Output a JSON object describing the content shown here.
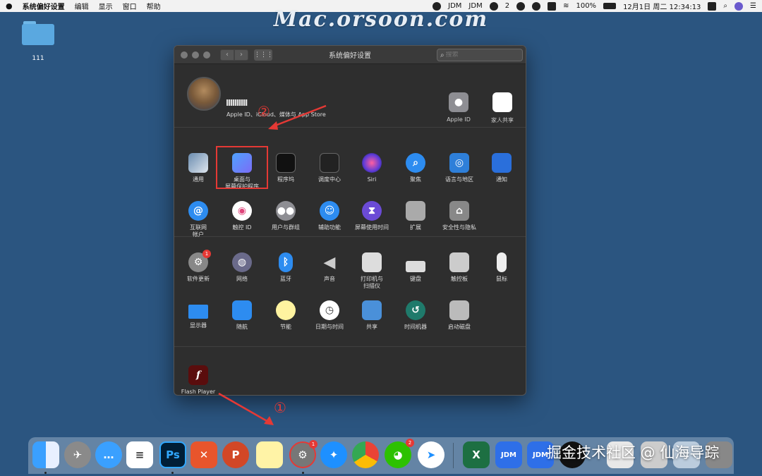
{
  "menubar": {
    "apple": "",
    "app_name": "系统偏好设置",
    "menus": [
      "编辑",
      "显示",
      "窗口",
      "帮助"
    ],
    "jdm1": "JDM",
    "jdm2": "JDM",
    "wechat_count": "2",
    "battery": "100%",
    "datetime": "12月1日 周二  12:34:13"
  },
  "watermark": "Mac.orsoon.com",
  "bottom_watermark": "掘金技术社区 @ 仙海导踪",
  "desktop": {
    "folder_label": "111"
  },
  "window": {
    "title": "系统偏好设置",
    "search_placeholder": "搜索",
    "grid_button": "⋮⋮⋮"
  },
  "account": {
    "description": "Apple ID、iCloud、媒体与 App Store",
    "apple_id": "Apple ID",
    "family": "家人共享"
  },
  "row1": [
    {
      "label": "通用",
      "name": "general"
    },
    {
      "label": "桌面与\n屏幕保护程序",
      "name": "desktop-screensaver"
    },
    {
      "label": "程序坞",
      "name": "dock"
    },
    {
      "label": "调度中心",
      "name": "mission-control"
    },
    {
      "label": "Siri",
      "name": "siri"
    },
    {
      "label": "聚焦",
      "name": "spotlight"
    },
    {
      "label": "语言与地区",
      "name": "language-region"
    },
    {
      "label": "通知",
      "name": "notifications"
    }
  ],
  "row2": [
    {
      "label": "互联网\n帐户",
      "name": "internet-accounts"
    },
    {
      "label": "触控 ID",
      "name": "touch-id"
    },
    {
      "label": "用户与群组",
      "name": "users-groups"
    },
    {
      "label": "辅助功能",
      "name": "accessibility"
    },
    {
      "label": "屏幕使用时间",
      "name": "screen-time"
    },
    {
      "label": "扩展",
      "name": "extensions"
    },
    {
      "label": "安全性与隐私",
      "name": "security-privacy"
    }
  ],
  "row3": [
    {
      "label": "软件更新",
      "name": "software-update",
      "badge": "1"
    },
    {
      "label": "网络",
      "name": "network"
    },
    {
      "label": "蓝牙",
      "name": "bluetooth"
    },
    {
      "label": "声音",
      "name": "sound"
    },
    {
      "label": "打印机与\n扫描仪",
      "name": "printers-scanners"
    },
    {
      "label": "键盘",
      "name": "keyboard"
    },
    {
      "label": "触控板",
      "name": "trackpad"
    },
    {
      "label": "鼠标",
      "name": "mouse"
    }
  ],
  "row4": [
    {
      "label": "显示器",
      "name": "displays"
    },
    {
      "label": "随航",
      "name": "sidecar"
    },
    {
      "label": "节能",
      "name": "energy-saver"
    },
    {
      "label": "日期与时间",
      "name": "date-time"
    },
    {
      "label": "共享",
      "name": "sharing"
    },
    {
      "label": "时间机器",
      "name": "time-machine"
    },
    {
      "label": "启动磁盘",
      "name": "startup-disk"
    }
  ],
  "other": [
    {
      "label": "Flash Player",
      "name": "flash-player"
    }
  ],
  "annotations": {
    "circle1": "①",
    "circle2": "②"
  },
  "dock": {
    "sysprefs_badge": "1",
    "wechat_badge": "2",
    "ps": "Ps",
    "jdm": "JDM"
  }
}
